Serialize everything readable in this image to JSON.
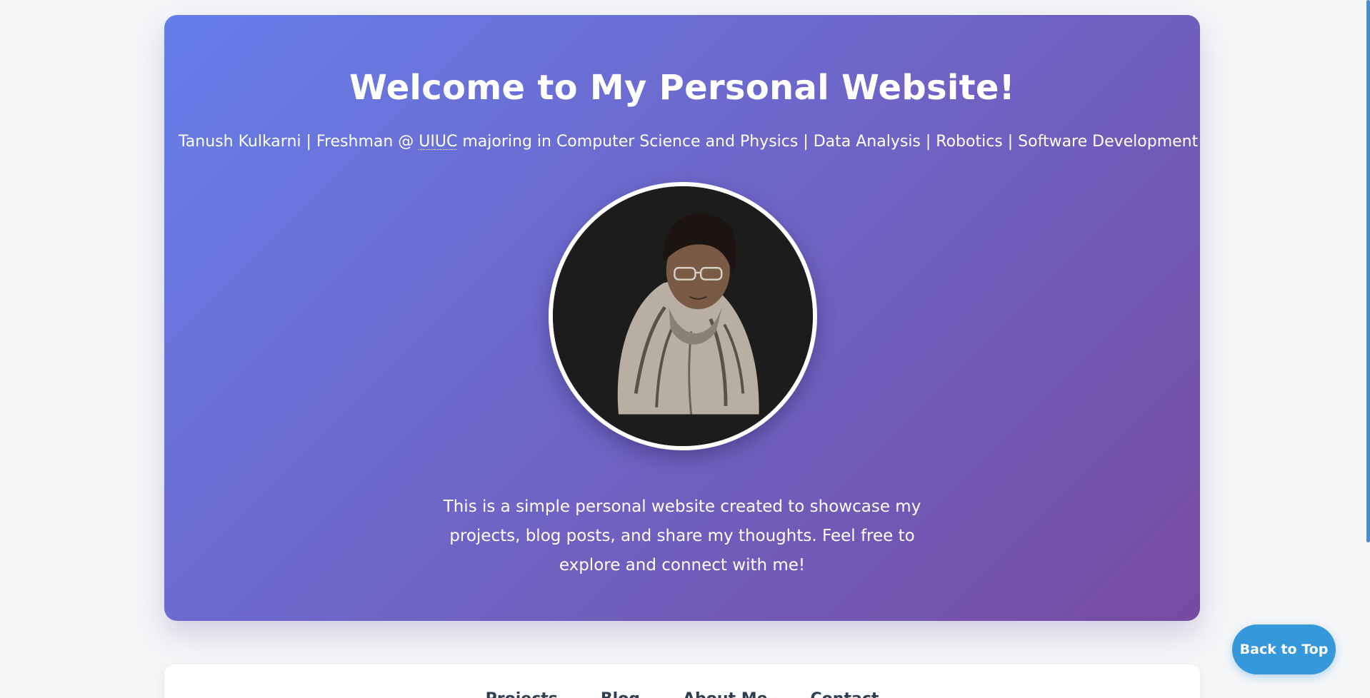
{
  "hero": {
    "title": "Welcome to My Personal Website!",
    "subtitle_before": "Tanush Kulkarni | Freshman @ ",
    "subtitle_abbr": "UIUC",
    "subtitle_after": " majoring in Computer Science and Physics | Data Analysis | Robotics | Software Development",
    "description": "This is a simple personal website created to showcase my projects, blog posts, and share my thoughts. Feel free to explore and connect with me!"
  },
  "nav": {
    "items": [
      {
        "label": "Projects"
      },
      {
        "label": "Blog"
      },
      {
        "label": "About Me"
      },
      {
        "label": "Contact"
      }
    ]
  },
  "back_to_top": {
    "label": "Back to Top"
  },
  "colors": {
    "hero_gradient_start": "#667eea",
    "hero_gradient_end": "#764ba2",
    "button_blue": "#3498db",
    "page_background": "#f5f6f8"
  }
}
